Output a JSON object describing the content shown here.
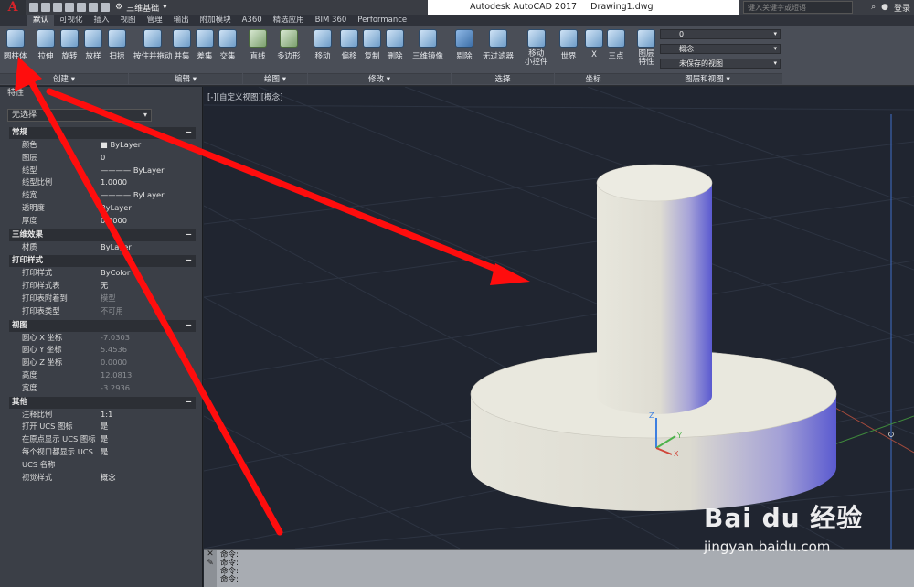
{
  "titlebar": {
    "app_logo": "A",
    "workspace": "三维基础",
    "app_name": "Autodesk AutoCAD 2017",
    "doc_name": "Drawing1.dwg",
    "search_placeholder": "键入关键字或短语",
    "login": "登录"
  },
  "tabs": [
    "默认",
    "可视化",
    "插入",
    "视图",
    "管理",
    "输出",
    "附加模块",
    "A360",
    "精选应用",
    "BIM 360",
    "Performance"
  ],
  "ribbon": {
    "tools": [
      {
        "name": "cylinder-tool",
        "label": "圆柱体"
      },
      {
        "name": "extrude-tool",
        "label": "拉伸"
      },
      {
        "name": "revolve-tool",
        "label": "旋转"
      },
      {
        "name": "loft-tool",
        "label": "放样"
      },
      {
        "name": "sweep-tool",
        "label": "扫掠"
      },
      {
        "name": "presspull-tool",
        "label": "按住并拖动"
      },
      {
        "name": "union-tool",
        "label": "并集"
      },
      {
        "name": "subtract-tool",
        "label": "差集"
      },
      {
        "name": "intersect-tool",
        "label": "交集"
      },
      {
        "name": "line-tool",
        "label": "直线"
      },
      {
        "name": "polygon-tool",
        "label": "多边形"
      },
      {
        "name": "move-tool",
        "label": "移动"
      },
      {
        "name": "offset-tool",
        "label": "偏移"
      },
      {
        "name": "copy-tool",
        "label": "复制"
      },
      {
        "name": "erase-tool",
        "label": "删除"
      },
      {
        "name": "mirror3d-tool",
        "label": "三维镜像"
      },
      {
        "name": "cull-tool",
        "label": "剔除"
      },
      {
        "name": "nofilter-tool",
        "label": "无过滤器"
      },
      {
        "name": "gizmo-tool",
        "label": "移动\n小控件"
      },
      {
        "name": "world-tool",
        "label": "世界"
      },
      {
        "name": "x-tool",
        "label": "X"
      },
      {
        "name": "threepoint-tool",
        "label": "三点"
      },
      {
        "name": "layer-props-tool",
        "label": "图层\n特性"
      }
    ],
    "panels": [
      "创建 ▾",
      "编辑 ▾",
      "绘图 ▾",
      "修改 ▾",
      "选择",
      "坐标",
      "图层和视图 ▾"
    ],
    "layer_value": "0",
    "visual_style": "概念",
    "view_value": "未保存的视图"
  },
  "properties": {
    "title": "特性",
    "selection": "无选择",
    "sections": [
      {
        "title": "常规",
        "rows": [
          [
            "颜色",
            "■ ByLayer"
          ],
          [
            "图层",
            "0"
          ],
          [
            "线型",
            "———— ByLayer"
          ],
          [
            "线型比例",
            "1.0000"
          ],
          [
            "线宽",
            "———— ByLayer"
          ],
          [
            "透明度",
            "ByLayer"
          ],
          [
            "厚度",
            "0.0000"
          ]
        ]
      },
      {
        "title": "三维效果",
        "rows": [
          [
            "材质",
            "ByLayer"
          ]
        ]
      },
      {
        "title": "打印样式",
        "rows": [
          [
            "打印样式",
            "ByColor"
          ],
          [
            "打印样式表",
            "无"
          ],
          [
            "打印表附着到",
            "模型"
          ],
          [
            "打印表类型",
            "不可用"
          ]
        ]
      },
      {
        "title": "视图",
        "rows": [
          [
            "圆心 X 坐标",
            "-7.0303"
          ],
          [
            "圆心 Y 坐标",
            "5.4536"
          ],
          [
            "圆心 Z 坐标",
            "0.0000"
          ],
          [
            "高度",
            "12.0813"
          ],
          [
            "宽度",
            "-3.2936"
          ]
        ]
      },
      {
        "title": "其他",
        "rows": [
          [
            "注释比例",
            "1:1"
          ],
          [
            "打开 UCS 图标",
            "是"
          ],
          [
            "在原点显示 UCS 图标",
            "是"
          ],
          [
            "每个视口都显示 UCS",
            "是"
          ],
          [
            "UCS 名称",
            ""
          ],
          [
            "视觉样式",
            "概念"
          ]
        ]
      }
    ]
  },
  "viewport": {
    "label": "[-][自定义视图][概念]"
  },
  "command": {
    "lines": [
      "命令:",
      "命令:",
      "命令:",
      "命令:"
    ]
  },
  "watermark": {
    "brand": "Bai du 经验",
    "url": "jingyan.baidu.com"
  },
  "colors": {
    "arrow": "#ff0d0d",
    "solid_shade": "#5a5ad0",
    "background": "#202530"
  }
}
